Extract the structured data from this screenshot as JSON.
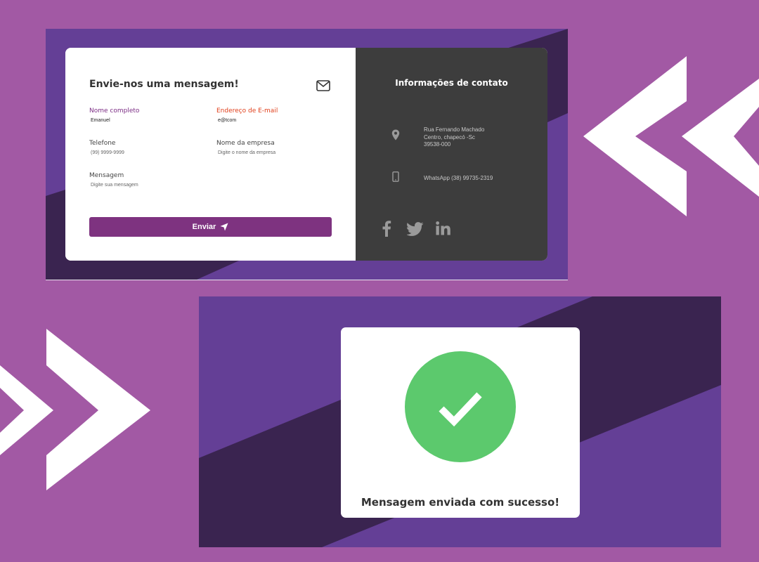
{
  "colors": {
    "background": "#a259a4",
    "stripe_dark": "#3a2450",
    "stripe_light": "#643f96",
    "accent_purple": "#7e3380",
    "label_red": "#e0401c",
    "contact_panel": "#3d3d3d",
    "success_green": "#5cc96d"
  },
  "form": {
    "title": "Envie-nos uma mensagem!",
    "title_icon": "envelope-icon",
    "fields": {
      "nome": {
        "label": "Nome completo",
        "value": "Emanuel"
      },
      "email": {
        "label": "Endereço de E-mail",
        "value": "e@tcom"
      },
      "telefone": {
        "label": "Telefone",
        "placeholder": "(99) 9999-9999"
      },
      "empresa": {
        "label": "Nome da empresa",
        "placeholder": "Digite o nome da empresa"
      },
      "mensagem": {
        "label": "Mensagem",
        "placeholder": "Digite sua mensagem"
      }
    },
    "submit_label": "Enviar",
    "submit_icon": "paper-plane-icon"
  },
  "contact": {
    "title": "Informações de contato",
    "address_lines": [
      "Rua Fernando Machado",
      "Centro, chapecó -Sc",
      "39538-000"
    ],
    "address_icon": "location-pin-icon",
    "whatsapp": "WhatsApp (38) 99735-2319",
    "whatsapp_icon": "mobile-phone-icon",
    "social_icons": [
      "facebook-icon",
      "twitter-icon",
      "linkedin-icon"
    ]
  },
  "success": {
    "message": "Mensagem enviada com sucesso!",
    "icon": "check-circle-icon"
  }
}
